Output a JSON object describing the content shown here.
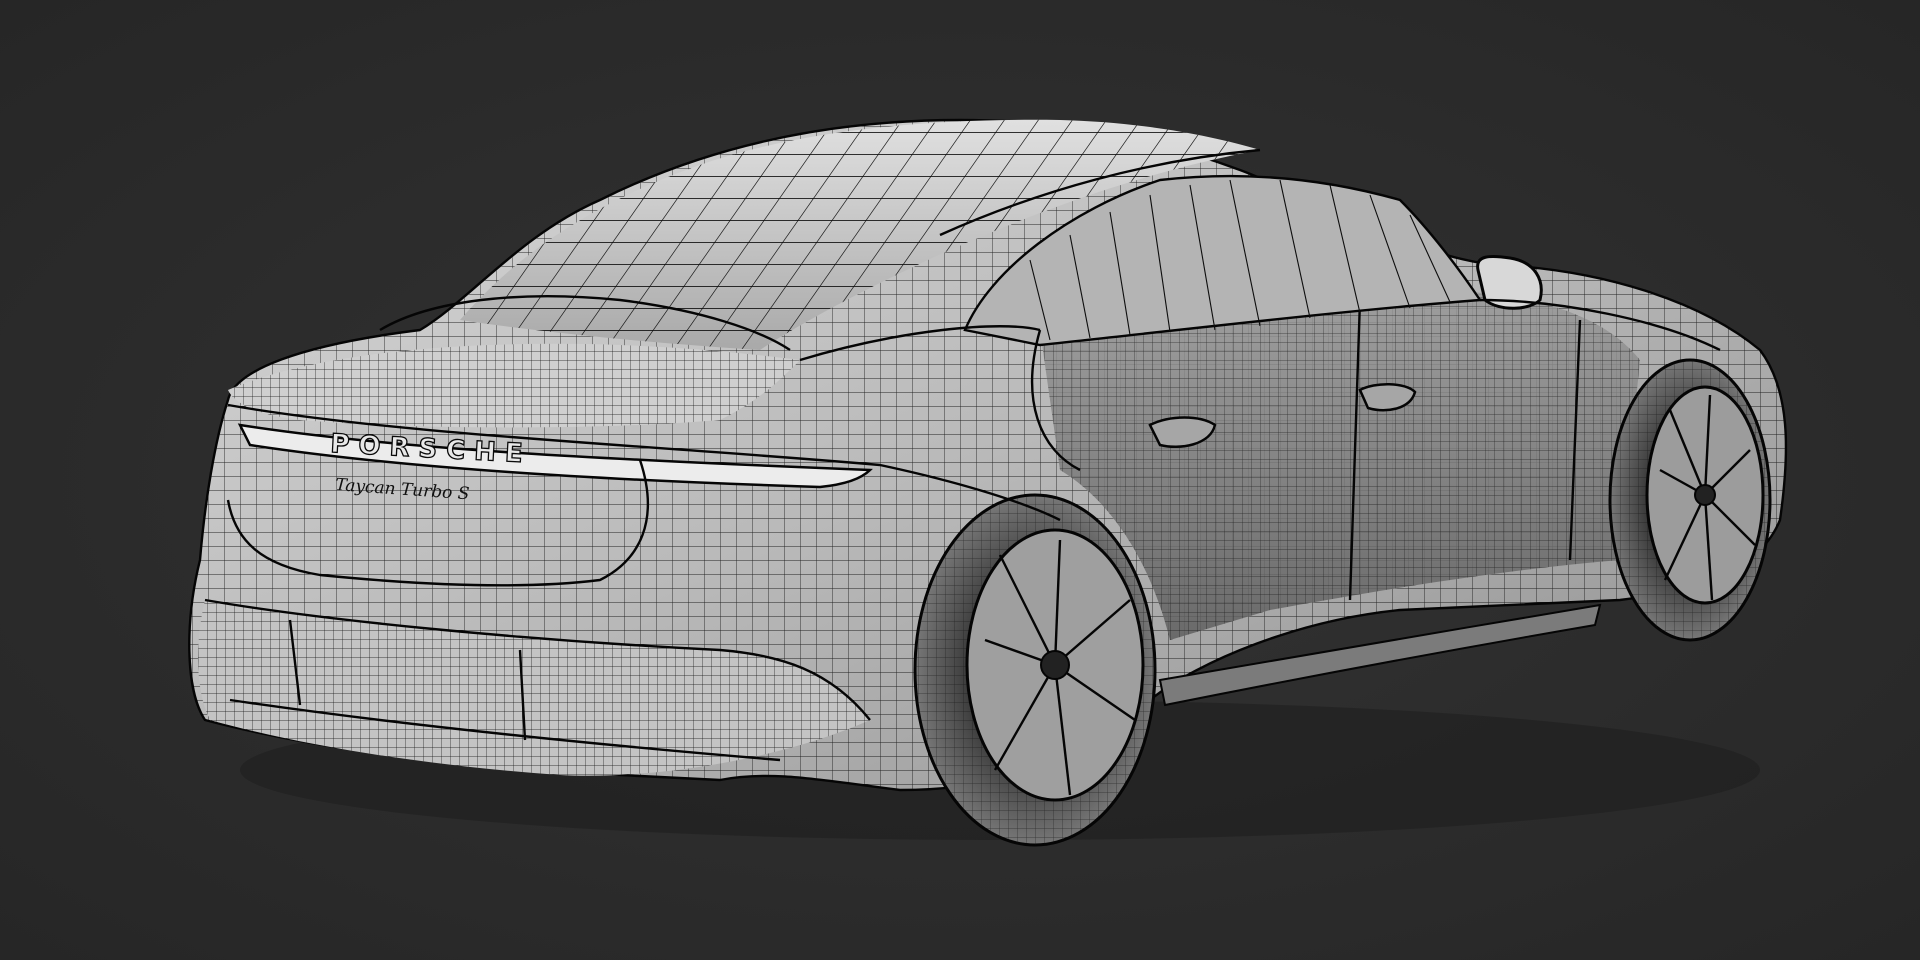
{
  "scene": {
    "background_color": "#2b2b2b",
    "mesh_color": "#c9c9c9",
    "wire_color": "#0d0d0d",
    "subject": "wireframe-car-model"
  },
  "badges": {
    "brand": "PORSCHE",
    "model": "Taycan Turbo S"
  }
}
